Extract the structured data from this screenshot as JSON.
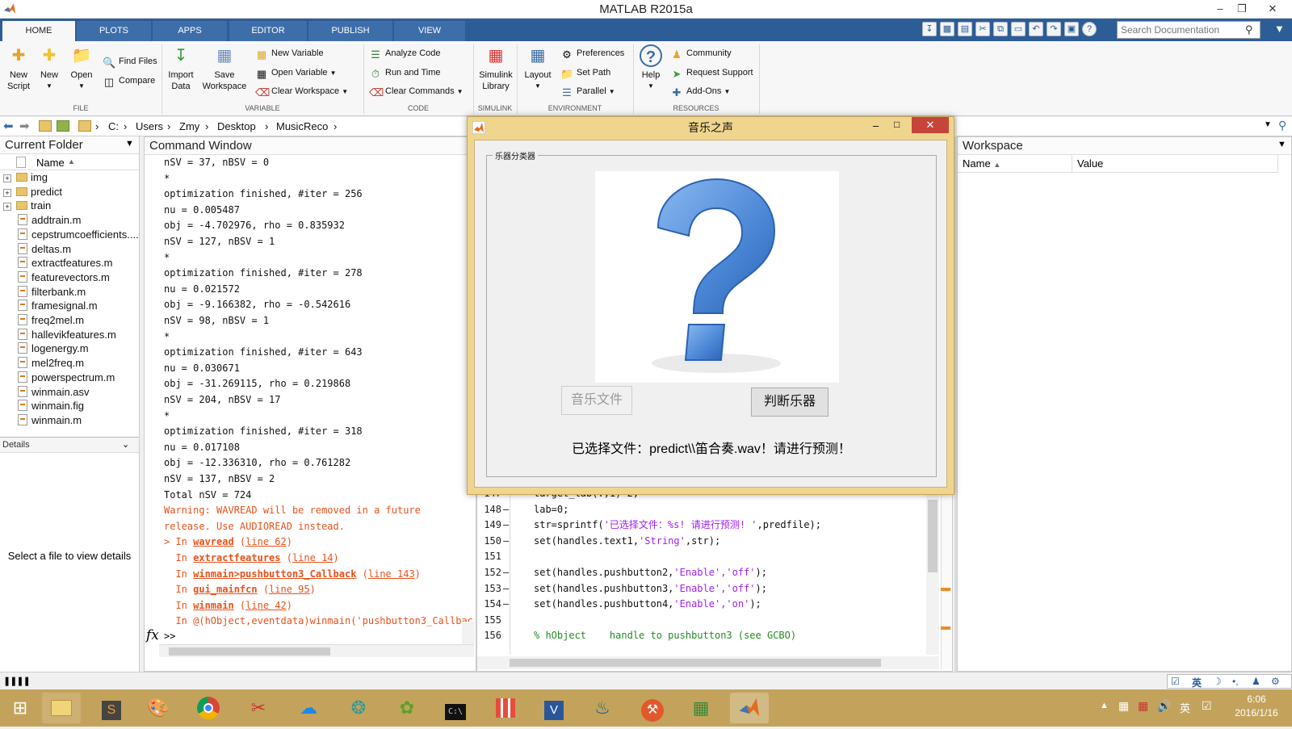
{
  "window": {
    "title": "MATLAB R2015a"
  },
  "tabs": [
    "HOME",
    "PLOTS",
    "APPS",
    "EDITOR",
    "PUBLISH",
    "VIEW"
  ],
  "search": {
    "placeholder": "Search Documentation"
  },
  "ribbon": {
    "file": {
      "group": "FILE",
      "new_script": "New\nScript",
      "new": "New",
      "open": "Open",
      "find_files": "Find Files",
      "compare": "Compare"
    },
    "variable": {
      "group": "VARIABLE",
      "import_data": "Import\nData",
      "save_workspace": "Save\nWorkspace",
      "new_variable": "New Variable",
      "open_variable": "Open Variable",
      "clear_workspace": "Clear Workspace"
    },
    "code": {
      "group": "CODE",
      "analyze_code": "Analyze Code",
      "run_and_time": "Run and Time",
      "clear_commands": "Clear Commands"
    },
    "simulink": {
      "group": "SIMULINK",
      "simulink_library": "Simulink\nLibrary"
    },
    "environment": {
      "group": "ENVIRONMENT",
      "layout": "Layout",
      "preferences": "Preferences",
      "set_path": "Set Path",
      "parallel": "Parallel"
    },
    "resources": {
      "group": "RESOURCES",
      "help": "Help",
      "community": "Community",
      "request_support": "Request Support",
      "add_ons": "Add-Ons"
    }
  },
  "address": {
    "crumbs": [
      "C:",
      "Users",
      "Zmy",
      "Desktop",
      "MusicReco"
    ]
  },
  "current_folder": {
    "title": "Current Folder",
    "col_name": "Name",
    "folders": [
      "img",
      "predict",
      "train"
    ],
    "files": [
      "addtrain.m",
      "cepstrumcoefficients....",
      "deltas.m",
      "extractfeatures.m",
      "featurevectors.m",
      "filterbank.m",
      "framesignal.m",
      "freq2mel.m",
      "hallevikfeatures.m",
      "logenergy.m",
      "mel2freq.m",
      "powerspectrum.m",
      "winmain.asv",
      "winmain.fig",
      "winmain.m"
    ],
    "details_title": "Details",
    "details_text": "Select a file to view details"
  },
  "command_window": {
    "title": "Command Window",
    "lines": [
      "nSV = 37, nBSV = 0",
      "*",
      "optimization finished, #iter = 256",
      "nu = 0.005487",
      "obj = -4.702976, rho = 0.835932",
      "nSV = 127, nBSV = 1",
      "*",
      "optimization finished, #iter = 278",
      "nu = 0.021572",
      "obj = -9.166382, rho = -0.542616",
      "nSV = 98, nBSV = 1",
      "*",
      "optimization finished, #iter = 643",
      "nu = 0.030671",
      "obj = -31.269115, rho = 0.219868",
      "nSV = 204, nBSV = 17",
      "*",
      "optimization finished, #iter = 318",
      "nu = 0.017108",
      "obj = -12.336310, rho = 0.761282",
      "nSV = 137, nBSV = 2",
      "Total nSV = 724"
    ],
    "warning": [
      "Warning: WAVREAD will be removed in a future",
      "release. Use AUDIOREAD instead."
    ],
    "trace": [
      {
        "pre": "> In ",
        "fn": "wavread",
        "ln": "line 62"
      },
      {
        "pre": "  In ",
        "fn": "extractfeatures",
        "ln": "line 14"
      },
      {
        "pre": "  In ",
        "fn": "winmain>pushbutton3_Callback",
        "ln": "line 143"
      },
      {
        "pre": "  In ",
        "fn": "gui_mainfcn",
        "ln": "line 95"
      },
      {
        "pre": "  In ",
        "fn": "winmain",
        "ln": "line 42"
      }
    ],
    "last_line": "  In @(hObject,eventdata)winmain('pushbutton3_Callbac",
    "prompt_fx": "fx",
    "prompt": ">>"
  },
  "editor": {
    "lines": [
      {
        "num": "147",
        "code": "target_lab(:,1)=2;"
      },
      {
        "num": "148",
        "code": "lab=0;"
      },
      {
        "num": "149",
        "code_pre": "str=sprintf(",
        "code_str": "'已选择文件：%s! 请进行预测! '",
        "code_post": ",predfile);"
      },
      {
        "num": "150",
        "code_pre": "set(handles.text1,",
        "code_str": "'String'",
        "code_post": ",str);"
      },
      {
        "num": "151",
        "code": ""
      },
      {
        "num": "152",
        "code_pre": "set(handles.pushbutton2,",
        "code_str": "'Enable','off'",
        "code_post": ");"
      },
      {
        "num": "153",
        "code_pre": "set(handles.pushbutton3,",
        "code_str": "'Enable','off'",
        "code_post": ");"
      },
      {
        "num": "154",
        "code_pre": "set(handles.pushbutton4,",
        "code_str": "'Enable','on'",
        "code_post": ");"
      },
      {
        "num": "155",
        "code": ""
      },
      {
        "num": "156",
        "comment": "% hObject    handle to pushbutton3 (see GCBO)"
      }
    ]
  },
  "workspace": {
    "title": "Workspace",
    "col_name": "Name",
    "col_value": "Value"
  },
  "dialog": {
    "title": "音乐之声",
    "group_label": "乐器分类器",
    "btn_music_file": "音乐文件",
    "btn_judge": "判断乐器",
    "status_text": "已选择文件：predict\\\\笛合奏.wav！请进行预测！"
  },
  "tray": {
    "lang": "英",
    "time": "6:06",
    "date": "2016/1/16"
  }
}
